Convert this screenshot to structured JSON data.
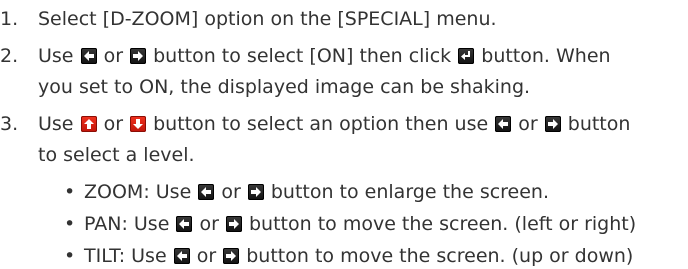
{
  "list": [
    {
      "number": "1.",
      "lines": [
        [
          "Select [D-ZOOM] option on the [SPECIAL] menu."
        ]
      ]
    },
    {
      "number": "2.",
      "lines": [
        [
          "Use ",
          {
            "icon": "left-arrow-icon"
          },
          " or ",
          {
            "icon": "right-arrow-icon"
          },
          " button to select [ON] then click ",
          {
            "icon": "enter-icon"
          },
          " button. When"
        ],
        [
          "you set to ON, the displayed image can be shaking."
        ]
      ]
    },
    {
      "number": "3.",
      "lines": [
        [
          "Use ",
          {
            "icon": "up-arrow-icon"
          },
          " or ",
          {
            "icon": "down-arrow-icon"
          },
          " button to select an option then use ",
          {
            "icon": "left-arrow-icon"
          },
          " or ",
          {
            "icon": "right-arrow-icon"
          },
          " button"
        ],
        [
          "to select a level."
        ]
      ]
    }
  ],
  "bullet_char": "•",
  "bullets": [
    [
      "ZOOM: Use ",
      {
        "icon": "left-arrow-icon"
      },
      " or ",
      {
        "icon": "right-arrow-icon"
      },
      " button to enlarge the screen."
    ],
    [
      "PAN: Use ",
      {
        "icon": "left-arrow-icon"
      },
      " or ",
      {
        "icon": "right-arrow-icon"
      },
      " button to move the screen. (left or right)"
    ],
    [
      "TILT: Use ",
      {
        "icon": "left-arrow-icon"
      },
      " or ",
      {
        "icon": "right-arrow-icon"
      },
      " button to move the screen. (up or down)"
    ]
  ],
  "colors": {
    "text": "#333333",
    "icon_dark": "#1a1a1a",
    "icon_red": "#d61e10"
  }
}
